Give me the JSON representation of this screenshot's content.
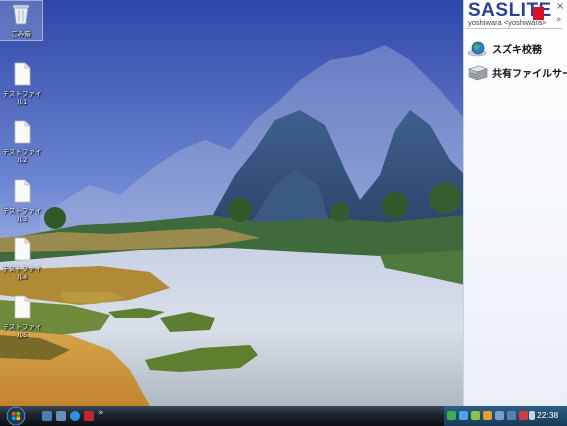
{
  "desktop": {
    "icons": [
      {
        "label": "ごみ箱",
        "kind": "recycle-bin"
      },
      {
        "label": "テストファイル1",
        "kind": "file"
      },
      {
        "label": "テストファイル2",
        "kind": "file"
      },
      {
        "label": "テストファイル3",
        "kind": "file"
      },
      {
        "label": "テストファイル4",
        "kind": "file"
      },
      {
        "label": "テストファイル5",
        "kind": "file"
      }
    ]
  },
  "sidebar": {
    "brand": "SASLITE",
    "user": "yoshiwara <yoshiwara>",
    "close_glyph": "×",
    "expand_glyph": "»",
    "items": [
      {
        "label": "スズキ校務",
        "icon": "globe-icon"
      },
      {
        "label": "共有ファイルサーバ",
        "icon": "server-icon"
      }
    ]
  },
  "taskbar": {
    "quicklaunch_more": "»",
    "clock": "22:38"
  },
  "colors": {
    "brand": "#2a3f96",
    "brand_mark": "#d8102c",
    "taskbar": "#1c242e",
    "tray": "#1e4566"
  }
}
